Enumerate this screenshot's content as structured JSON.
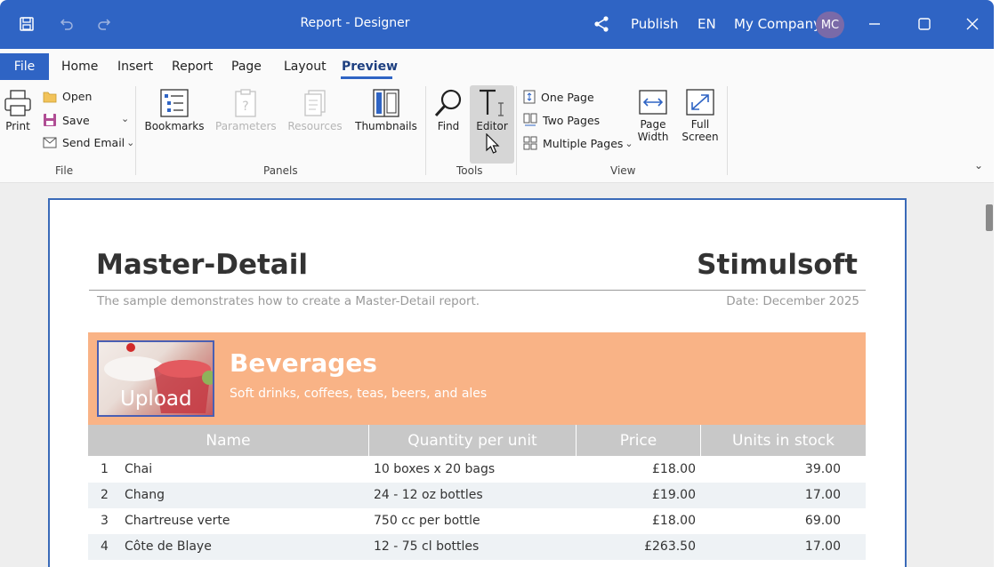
{
  "window": {
    "title": "Report - Designer",
    "publish_label": "Publish",
    "language": "EN",
    "company": "My Company",
    "avatar_initials": "MC"
  },
  "tabs": [
    {
      "label": "File"
    },
    {
      "label": "Home"
    },
    {
      "label": "Insert"
    },
    {
      "label": "Report"
    },
    {
      "label": "Page"
    },
    {
      "label": "Layout"
    },
    {
      "label": "Preview"
    }
  ],
  "ribbon": {
    "file_group": {
      "label": "File",
      "print": "Print",
      "open": "Open",
      "save": "Save",
      "send_email": "Send Email"
    },
    "panels_group": {
      "label": "Panels",
      "bookmarks": "Bookmarks",
      "parameters": "Parameters",
      "resources": "Resources",
      "thumbnails": "Thumbnails"
    },
    "tools_group": {
      "label": "Tools",
      "find": "Find",
      "editor": "Editor"
    },
    "view_group": {
      "label": "View",
      "one_page": "One Page",
      "two_pages": "Two Pages",
      "multiple_pages": "Multiple Pages",
      "page_width_1": "Page",
      "page_width_2": "Width",
      "full_screen_1": "Full",
      "full_screen_2": "Screen"
    }
  },
  "report": {
    "title": "Master-Detail",
    "brand": "Stimulsoft",
    "description": "The sample demonstrates how to create a Master-Detail report.",
    "date": "Date: December 2025",
    "category": {
      "name": "Beverages",
      "description": "Soft drinks, coffees, teas, beers, and ales",
      "image_label": "Upload"
    },
    "columns": [
      "Name",
      "Quantity per unit",
      "Price",
      "Units in stock"
    ],
    "rows": [
      {
        "num": "1",
        "name": "Chai",
        "qty": "10 boxes x 20 bags",
        "price": "£18.00",
        "stock": "39.00"
      },
      {
        "num": "2",
        "name": "Chang",
        "qty": "24 - 12 oz bottles",
        "price": "£19.00",
        "stock": "17.00"
      },
      {
        "num": "3",
        "name": "Chartreuse verte",
        "qty": "750 cc per bottle",
        "price": "£18.00",
        "stock": "69.00"
      },
      {
        "num": "4",
        "name": "Côte de Blaye",
        "qty": "12 - 75 cl bottles",
        "price": "£263.50",
        "stock": "17.00"
      }
    ]
  },
  "colors": {
    "accent": "#2f64c4",
    "category_band": "#f9b386",
    "header_row": "#c8c8c8"
  }
}
